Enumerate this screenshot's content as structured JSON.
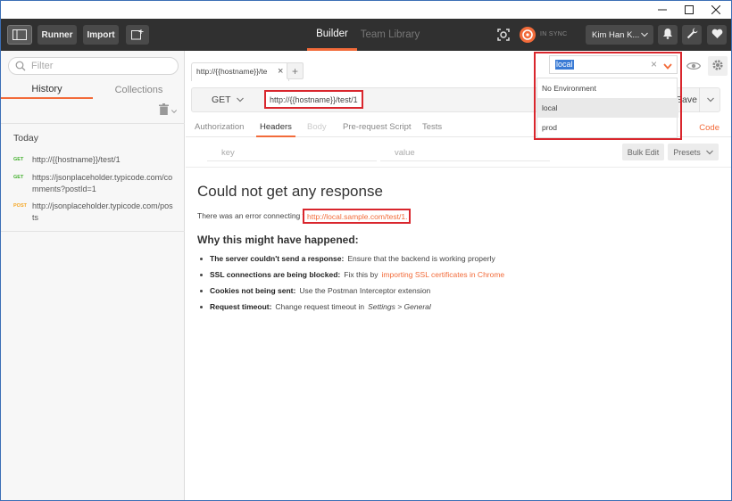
{
  "window": {
    "controls": [
      "minimize-icon",
      "maximize-icon",
      "close-icon"
    ]
  },
  "header": {
    "runner_label": "Runner",
    "import_label": "Import",
    "tabs": {
      "builder": "Builder",
      "team_library": "Team Library"
    },
    "sync_status": "IN SYNC",
    "user": "Kim Han K...",
    "accent_color": "#f26b3a",
    "icons": [
      "sidebar-toggle-icon",
      "new-window-icon",
      "interceptor-icon",
      "sync-icon",
      "bell-icon",
      "wrench-icon",
      "heart-icon"
    ]
  },
  "sidebar": {
    "filter_placeholder": "Filter",
    "tabs": {
      "history": "History",
      "collections": "Collections"
    },
    "group_label": "Today",
    "history": [
      {
        "method": "GET",
        "url": "http://{{hostname}}/test/1"
      },
      {
        "method": "GET",
        "url": "https://jsonplaceholder.typicode.com/comments?postId=1"
      },
      {
        "method": "POST",
        "url": "http://jsonplaceholder.typicode.com/posts"
      }
    ]
  },
  "request": {
    "tab_title": "http://{{hostname}}/te",
    "method": "GET",
    "url": "http://{{hostname}}/test/1",
    "save_label": "Save",
    "subtabs": [
      "Authorization",
      "Headers",
      "Body",
      "Pre-request Script",
      "Tests"
    ],
    "active_subtab": "Headers",
    "code_link": "Code",
    "key_placeholder": "key",
    "value_placeholder": "value",
    "bulk_edit_label": "Bulk Edit",
    "presets_label": "Presets"
  },
  "response": {
    "title": "Could not get any response",
    "error_prefix": "There was an error connecting to",
    "error_url": "http://local.sample.com/test/1.",
    "why_title": "Why this might have happened:",
    "reasons": [
      {
        "bold": "The server couldn't send a response:",
        "text": "Ensure that the backend is working properly"
      },
      {
        "bold": "SSL connections are being blocked:",
        "text": "Fix this by",
        "link": "importing SSL certificates in Chrome"
      },
      {
        "bold": "Cookies not being sent:",
        "text": "Use the Postman Interceptor extension"
      },
      {
        "bold": "Request timeout:",
        "text": "Change request timeout in",
        "italic": "Settings > General"
      }
    ]
  },
  "environment": {
    "selected": "local",
    "options": [
      "No Environment",
      "local",
      "prod"
    ],
    "highlighted": "local"
  }
}
